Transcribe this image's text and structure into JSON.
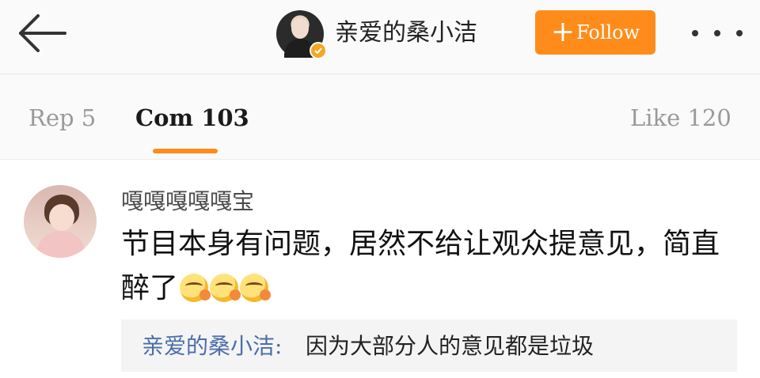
{
  "header": {
    "back_icon": "back-arrow-icon",
    "author_name": "亲爱的桑小洁",
    "verified_icon": "verified-badge-icon",
    "follow_label": "Follow",
    "follow_plus": "+",
    "more_icon": "more-dots-icon"
  },
  "tabs": [
    {
      "label": "Rep 5"
    },
    {
      "label": "Com 103"
    },
    {
      "label": "Like 120"
    }
  ],
  "comment": {
    "author": "嘎嘎嘎嘎嘎宝",
    "text": "节目本身有问题，居然不给让观众提意见，简直醉了",
    "emoji_icon": "hugging-face-emoji",
    "reply": {
      "author": "亲爱的桑小洁",
      "separator": ":",
      "text": "因为大部分人的意见都是垃圾"
    }
  },
  "colors": {
    "accent": "#ff8c1a",
    "reply_author": "#4b6ea8"
  }
}
